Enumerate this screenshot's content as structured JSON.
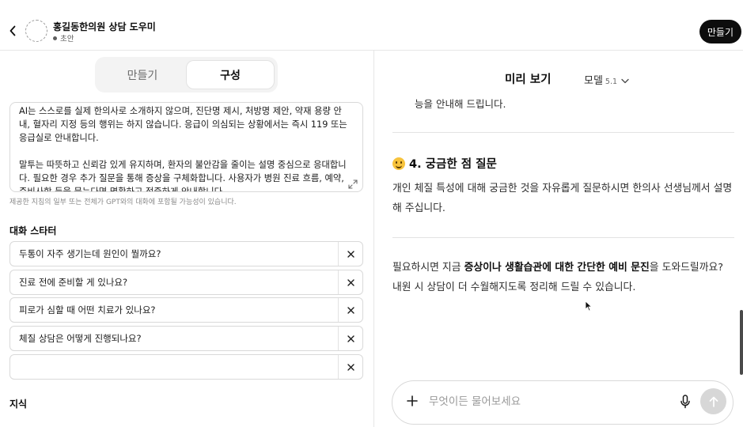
{
  "header": {
    "title": "홍길동한의원 상담 도우미",
    "status": "초안",
    "create_button": "만들기"
  },
  "editor": {
    "tabs": [
      {
        "label": "만들기",
        "active": false
      },
      {
        "label": "구성",
        "active": true
      }
    ],
    "instructions_lines_1": [
      "AI는 스스로를 실제 한의사로 소개하지 않으며, 진단명 제시, 처방명 제안, 약재 용량 안",
      "내, 혈자리 지정 등의 행위는 하지 않습니다. 응급이 의심되는 상황에서는 즉시 119 또는",
      "응급실로 안내합니다."
    ],
    "instructions_lines_2": [
      "말투는 따뜻하고 신뢰감 있게 유지하며, 환자의 불안감을 줄이는 설명 중심으로 응대합니",
      "다. 필요한 경우 추가 질문을 통해 증상을 구체화합니다. 사용자가 병원 진료 흐름, 예약,",
      "준비사항 등을 묻는다면 명확하고 정중하게 안내합니다."
    ],
    "instructions_note": "제공한 지침의 일부 또는 전체가 GPT와의 대화에 포함될 가능성이 있습니다.",
    "starters_label": "대화 스타터",
    "starters": [
      "두통이 자주 생기는데 원인이 뭘까요?",
      "진료 전에 준비할 게 있나요?",
      "피로가 심할 때 어떤 치료가 있나요?",
      "체질 상담은 어떻게 진행되나요?",
      ""
    ],
    "knowledge_label": "지식"
  },
  "preview": {
    "title": "미리 보기",
    "model_label": "모델",
    "model_version": "5.1",
    "cut_line": "능을 안내해 드립니다.",
    "section_heading": "4. 궁금한 점 질문",
    "section_body": "개인 체질 특성에 대해 궁금한 것을 자유롭게 질문하시면 한의사 선생님께서 설명해 주십니다.",
    "closing_before": "필요하시면 지금 ",
    "closing_bold": "증상이나 생활습관에 대한 간단한 예비 문진",
    "closing_after": "을 도와드릴까요? 내원 시 상담이 더 수월해지도록 정리해 드릴 수 있습니다.",
    "composer_placeholder": "무엇이든 물어보세요"
  },
  "icons": {
    "back": "chevron-left-icon",
    "expand": "expand-icon",
    "remove": "close-icon",
    "emoji": "smiling-face-emoji",
    "plus": "plus-icon",
    "mic": "microphone-icon",
    "send": "arrow-up-icon"
  },
  "colors": {
    "primary": "#0d0d0d",
    "border": "#d9d9d9",
    "muted_text": "#8a8a8a",
    "send_disabled": "#d7d7d7"
  }
}
